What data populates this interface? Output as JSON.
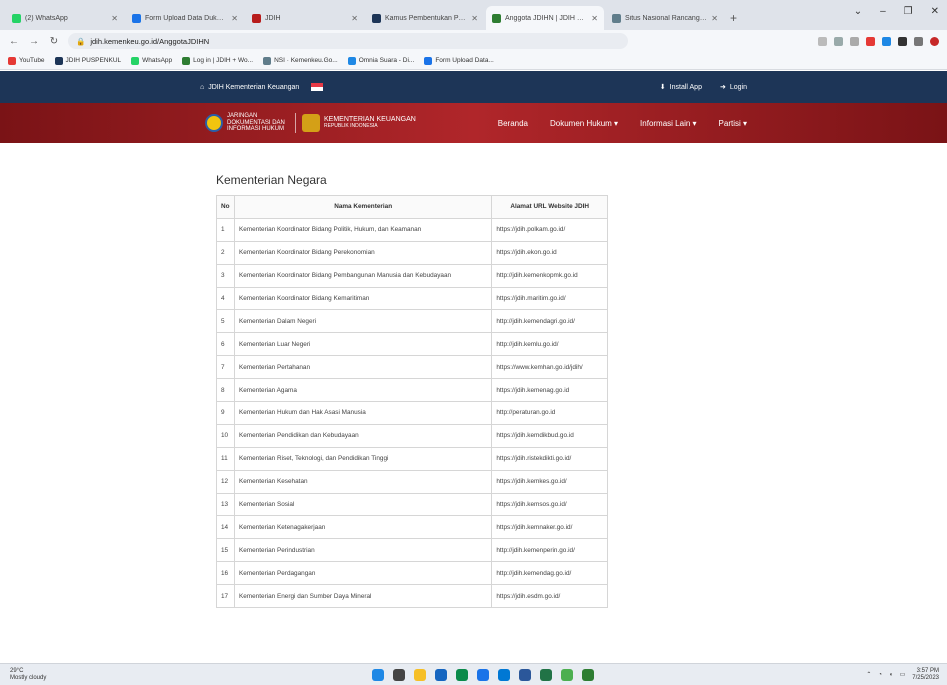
{
  "browser": {
    "tabs": [
      {
        "title": "(2) WhatsApp",
        "color": "#25d366",
        "active": false
      },
      {
        "title": "Form Upload Data Dukung Ren",
        "color": "#1a73e8",
        "active": false
      },
      {
        "title": "JDIH",
        "color": "#b71c1c",
        "active": false
      },
      {
        "title": "Kamus Pembentukan Produk Huk",
        "color": "#1d3557",
        "active": false
      },
      {
        "title": "Anggota JDIHN | JDIH Kementer",
        "color": "#2e7d32",
        "active": true
      },
      {
        "title": "Situs Nasional Rancangan Pera",
        "color": "#607d8b",
        "active": false
      }
    ],
    "new_tab": "+",
    "window_controls": [
      "⌄",
      "–",
      "❐",
      "✕"
    ],
    "url": "jdih.kemenkeu.go.id/AnggotaJDIHN",
    "bookmarks": [
      {
        "label": "YouTube",
        "color": "#e53935"
      },
      {
        "label": "JDIH PUSPENKUL",
        "color": "#1d3557"
      },
      {
        "label": "WhatsApp",
        "color": "#25d366"
      },
      {
        "label": "Log in | JDIH + Wo...",
        "color": "#2e7d32"
      },
      {
        "label": "NSI · Kemenkeu.Go...",
        "color": "#607d8b"
      },
      {
        "label": "Omnia Suara - Di...",
        "color": "#1e88e5"
      },
      {
        "label": "Form Upload Data...",
        "color": "#1a73e8"
      }
    ]
  },
  "site": {
    "top_name": "JDIH Kementerian Keuangan",
    "top_links": [
      "Install App",
      "Login"
    ],
    "logo1_text": "JARINGAN DOKUMENTASI DAN INFORMASI HUKUM",
    "logo2_text": "KEMENTERIAN KEUANGAN",
    "logo2_sub": "REPUBLIK INDONESIA",
    "menu": [
      "Beranda",
      "Dokumen Hukum ▾",
      "Informasi Lain ▾",
      "Partisi ▾"
    ]
  },
  "page": {
    "title": "Kementerian Negara",
    "headers": {
      "no": "No",
      "name": "Nama Kementerian",
      "url": "Alamat URL Website JDIH"
    },
    "rows": [
      {
        "no": "1",
        "name": "Kementerian Koordinator Bidang Politik, Hukum, dan Keamanan",
        "url": "https://jdih.polkam.go.id/"
      },
      {
        "no": "2",
        "name": "Kementerian Koordinator Bidang Perekonomian",
        "url": "https://jdih.ekon.go.id"
      },
      {
        "no": "3",
        "name": "Kementerian Koordinator Bidang Pembangunan Manusia dan Kebudayaan",
        "url": "http://jdih.kemenkopmk.go.id"
      },
      {
        "no": "4",
        "name": "Kementerian Koordinator Bidang Kemaritiman",
        "url": "https://jdih.maritim.go.id/"
      },
      {
        "no": "5",
        "name": "Kementerian Dalam Negeri",
        "url": "http://jdih.kemendagri.go.id/"
      },
      {
        "no": "6",
        "name": "Kementerian Luar Negeri",
        "url": "http://jdih.kemlu.go.id/"
      },
      {
        "no": "7",
        "name": "Kementerian Pertahanan",
        "url": "https://www.kemhan.go.id/jdih/"
      },
      {
        "no": "8",
        "name": "Kementerian Agama",
        "url": "https://jdih.kemenag.go.id"
      },
      {
        "no": "9",
        "name": "Kementerian Hukum dan Hak Asasi Manusia",
        "url": "http://peraturan.go.id"
      },
      {
        "no": "10",
        "name": "Kementerian Pendidikan dan Kebudayaan",
        "url": "https://jdih.kemdikbud.go.id"
      },
      {
        "no": "11",
        "name": "Kementerian Riset, Teknologi, dan Pendidikan Tinggi",
        "url": "https://jdih.ristekdikti.go.id/"
      },
      {
        "no": "12",
        "name": "Kementerian Kesehatan",
        "url": "https://jdih.kemkes.go.id/"
      },
      {
        "no": "13",
        "name": "Kementerian Sosial",
        "url": "https://jdih.kemsos.go.id/"
      },
      {
        "no": "14",
        "name": "Kementerian Ketenagakerjaan",
        "url": "https://jdih.kemnaker.go.id/"
      },
      {
        "no": "15",
        "name": "Kementerian Perindustrian",
        "url": "http://jdih.kemenperin.go.id/"
      },
      {
        "no": "16",
        "name": "Kementerian Perdagangan",
        "url": "http://jdih.kemendag.go.id/"
      },
      {
        "no": "17",
        "name": "Kementerian Energi dan Sumber Daya Mineral",
        "url": "https://jdih.esdm.go.id/"
      }
    ]
  },
  "taskbar": {
    "weather_temp": "29°C",
    "weather_desc": "Mostly cloudy",
    "icon_colors": [
      "#1e88e5",
      "#444",
      "#f6bf26",
      "#1565c0",
      "#0a8a4a",
      "#1a73e8",
      "#0078d4",
      "#2b579a",
      "#217346",
      "#4caf50",
      "#2e7d32"
    ],
    "time": "3:57 PM",
    "date": "7/25/2023"
  }
}
